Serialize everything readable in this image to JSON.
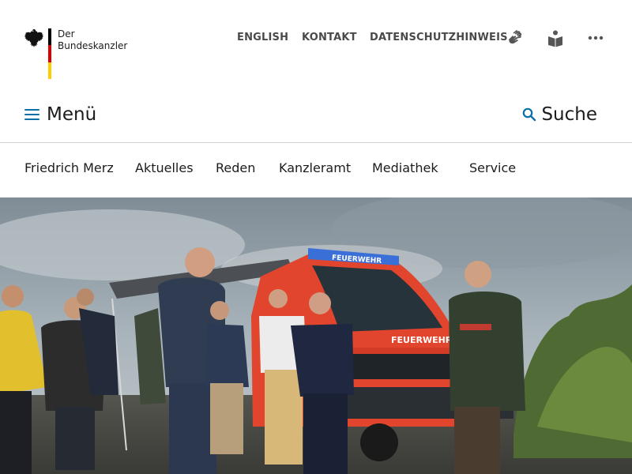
{
  "logo": {
    "line1": "Der",
    "line2": "Bundeskanzler",
    "flag_colors": [
      "#000000",
      "#dd0000",
      "#ffcc00"
    ]
  },
  "meta_nav": {
    "links": [
      {
        "label": "ENGLISH"
      },
      {
        "label": "KONTAKT"
      },
      {
        "label": "DATENSCHUTZHINWEIS"
      }
    ],
    "icons": [
      "sign-language-icon",
      "easy-language-icon",
      "more-options-icon"
    ]
  },
  "header": {
    "menu_label": "Menü",
    "search_label": "Suche"
  },
  "main_nav": {
    "items": [
      {
        "label": "Friedrich Merz"
      },
      {
        "label": "Aktuelles"
      },
      {
        "label": "Reden"
      },
      {
        "label": "Kanzleramt"
      },
      {
        "label": "Mediathek"
      },
      {
        "label": "Service"
      }
    ]
  },
  "hero": {
    "vehicle_text": "FEUERWEHR"
  },
  "colors": {
    "accent": "#0b6ea8",
    "text": "#1c1c1c",
    "meta_text": "#4a4a4a",
    "divider": "#d6d6d6"
  }
}
